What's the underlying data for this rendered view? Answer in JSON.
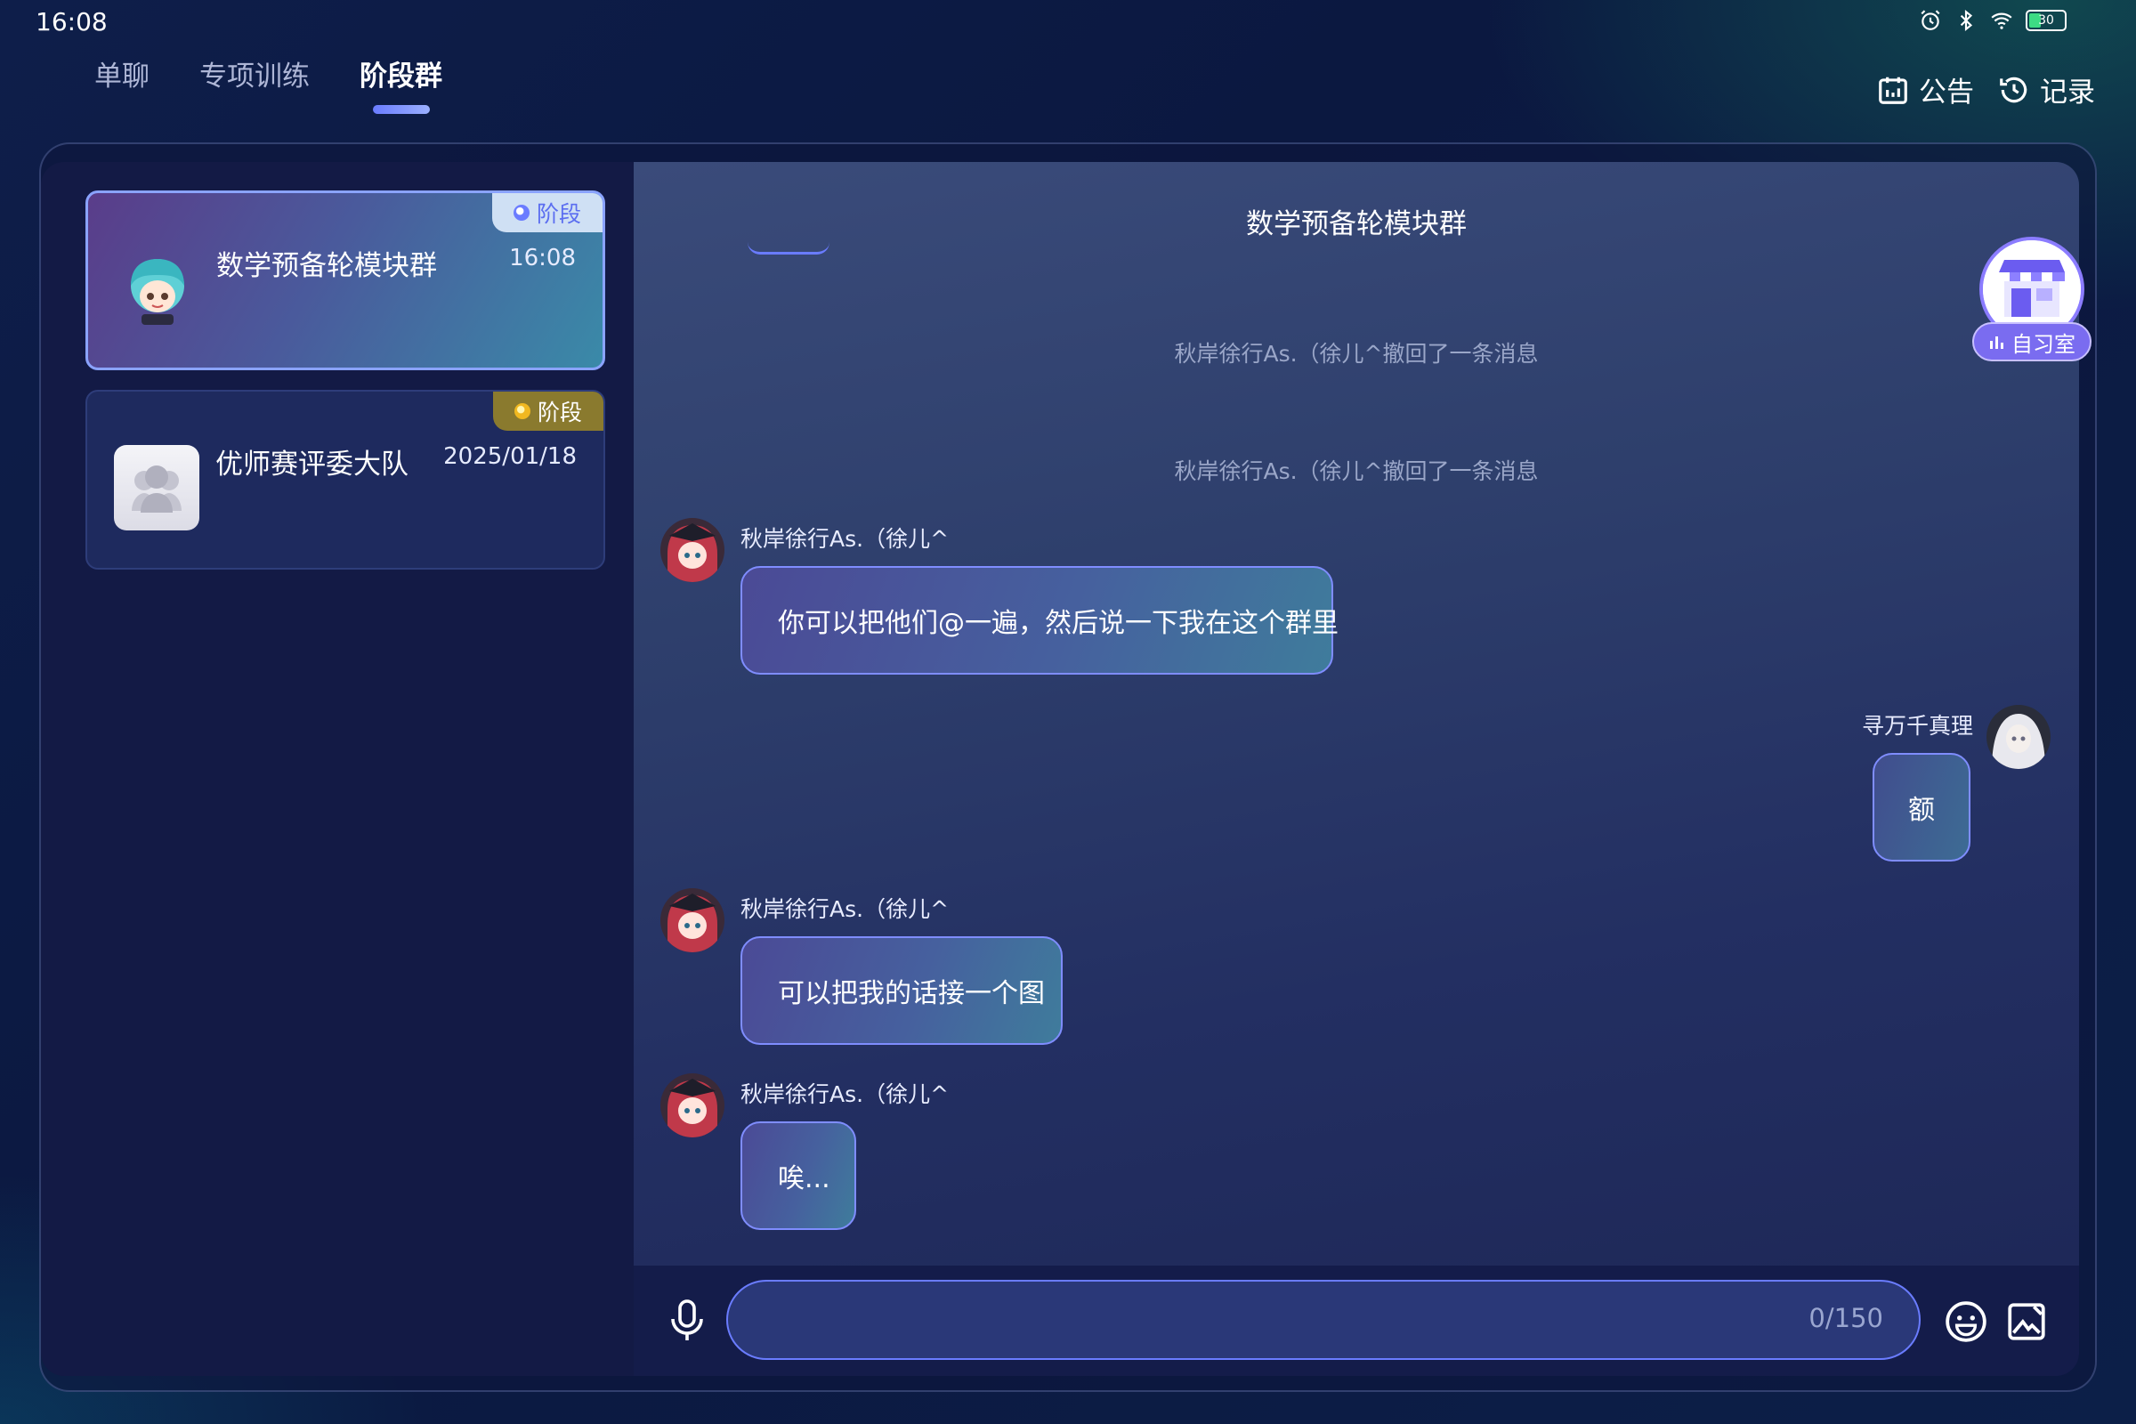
{
  "status_bar": {
    "time": "16:08",
    "battery": "30",
    "icons": [
      "alarm-icon",
      "bluetooth-icon",
      "wifi-icon",
      "battery-icon"
    ]
  },
  "tabs": [
    {
      "label": "单聊",
      "active": false
    },
    {
      "label": "专项训练",
      "active": false
    },
    {
      "label": "阶段群",
      "active": true
    }
  ],
  "top_actions": {
    "announcement": "公告",
    "history": "记录"
  },
  "conversations": [
    {
      "name": "数学预备轮模块群",
      "time": "16:08",
      "badge": "阶段",
      "selected": true
    },
    {
      "name": "优师赛评委大队",
      "time": "2025/01/18",
      "badge": "阶段",
      "selected": false
    }
  ],
  "chat": {
    "title": "数学预备轮模块群",
    "system_messages": [
      "秋岸徐行As.（徐儿^撤回了一条消息",
      "秋岸徐行As.（徐儿^撤回了一条消息"
    ],
    "messages": [
      {
        "sender": "秋岸徐行As.（徐儿^",
        "text": "你可以把他们@一遍，然后说一下我在这个群里",
        "side": "left"
      },
      {
        "sender": "寻万千真理",
        "text": "额",
        "side": "right"
      },
      {
        "sender": "秋岸徐行As.（徐儿^",
        "text": "可以把我的话接一个图",
        "side": "left"
      },
      {
        "sender": "秋岸徐行As.（徐儿^",
        "text": "唉...",
        "side": "left"
      }
    ]
  },
  "study_room": {
    "label": "自习室"
  },
  "input": {
    "counter": "0/150"
  },
  "colors": {
    "accent": "#6a7cff",
    "badge_blue_bg": "#cfe0f4",
    "badge_gold_bg": "#8a7a2e"
  }
}
